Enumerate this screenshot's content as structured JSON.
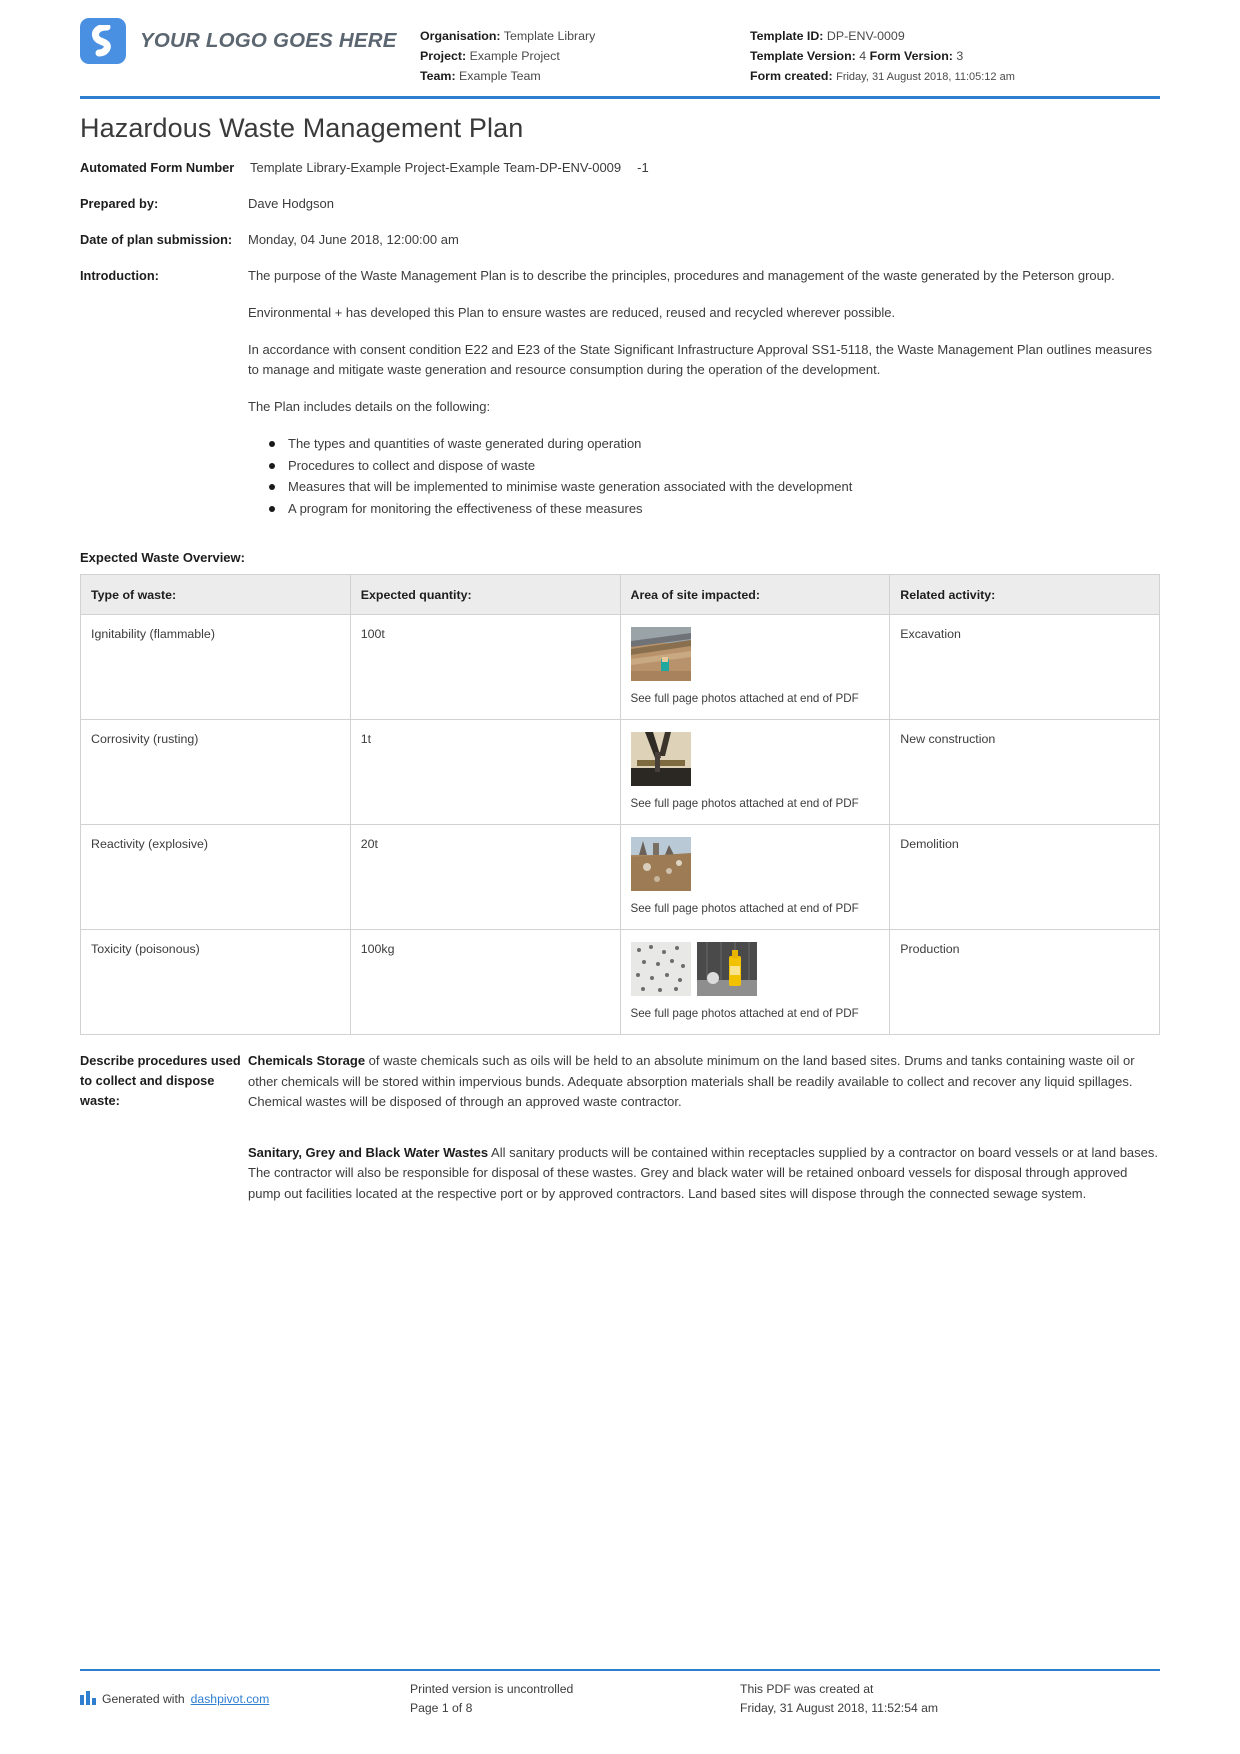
{
  "header": {
    "logo_text": "YOUR LOGO GOES HERE",
    "logo_icon": "dashpivot-logo-icon",
    "accent_color": "#2f7fd1",
    "left_meta": [
      {
        "label": "Organisation:",
        "value": "Template Library"
      },
      {
        "label": "Project:",
        "value": "Example Project"
      },
      {
        "label": "Team:",
        "value": "Example Team"
      }
    ],
    "right_meta": {
      "template_id_label": "Template ID:",
      "template_id_value": "DP-ENV-0009",
      "template_version_label": "Template Version:",
      "template_version_value": "4",
      "form_version_label": "Form Version:",
      "form_version_value": "3",
      "form_created_label": "Form created:",
      "form_created_value": "Friday, 31 August 2018, 11:05:12 am"
    }
  },
  "title": "Hazardous Waste Management Plan",
  "fields": {
    "form_number_label": "Automated Form Number",
    "form_number_value": "Template Library-Example Project-Example Team-DP-ENV-0009",
    "form_number_suffix": "-1",
    "prepared_by_label": "Prepared by:",
    "prepared_by_value": "Dave Hodgson",
    "date_label": "Date of plan submission:",
    "date_value": "Monday, 04 June 2018, 12:00:00 am",
    "introduction_label": "Introduction:"
  },
  "introduction": {
    "paragraphs": [
      "The purpose of the Waste Management Plan is to describe the principles, procedures and management of the waste generated by the Peterson group.",
      "Environmental + has developed this Plan to ensure wastes are reduced, reused and recycled wherever possible.",
      "In accordance with consent condition E22 and E23 of the State Significant Infrastructure Approval SS1-5118, the Waste Management Plan outlines measures to manage and mitigate waste generation and resource consumption during the operation of the development.",
      "The Plan includes details on the following:"
    ],
    "bullets": [
      "The types and quantities of waste generated during operation",
      "Procedures to collect and dispose of waste",
      "Measures that will be implemented to minimise waste generation associated with the development",
      "A program for monitoring the effectiveness of these measures"
    ]
  },
  "waste_table": {
    "heading": "Expected Waste Overview:",
    "columns": [
      "Type of waste:",
      "Expected quantity:",
      "Area of site impacted:",
      "Related activity:"
    ],
    "photo_caption": "See full page photos attached at end of PDF",
    "rows": [
      {
        "type": "Ignitability (flammable)",
        "quantity": "100t",
        "photos": 1,
        "photo_kind": "excavation-trench-photo",
        "activity": "Excavation"
      },
      {
        "type": "Corrosivity (rusting)",
        "quantity": "1t",
        "photos": 1,
        "photo_kind": "rusted-steel-photo",
        "activity": "New construction"
      },
      {
        "type": "Reactivity (explosive)",
        "quantity": "20t",
        "photos": 1,
        "photo_kind": "demolition-rubble-photo",
        "activity": "Demolition"
      },
      {
        "type": "Toxicity (poisonous)",
        "quantity": "100kg",
        "photos": 2,
        "photo_kind": "chemical-containers-photo",
        "activity": "Production"
      }
    ]
  },
  "procedures": {
    "label": "Describe procedures used to collect and dispose waste:",
    "blocks": [
      {
        "lead": "Chemicals Storage",
        "text": " of waste chemicals such as oils will be held to an absolute minimum on the land based sites. Drums and tanks containing waste oil or other chemicals will be stored within impervious bunds. Adequate absorption materials shall be readily available to collect and recover any liquid spillages. Chemical wastes will be disposed of through an approved waste contractor."
      },
      {
        "lead": "Sanitary, Grey and Black Water Wastes",
        "text": " All sanitary products will be contained within receptacles supplied by a contractor on board vessels or at land bases. The contractor will also be responsible for disposal of these wastes. Grey and black water will be retained onboard vessels for disposal through approved pump out facilities located at the respective port or by approved contractors. Land based sites will dispose through the connected sewage system."
      }
    ]
  },
  "footer": {
    "generated_prefix": "Generated with ",
    "generated_link": "dashpivot.com",
    "uncontrolled": "Printed version is uncontrolled",
    "page_label": "Page 1 of 8",
    "created_label": "This PDF was created at",
    "created_value": "Friday, 31 August 2018, 11:52:54 am"
  }
}
